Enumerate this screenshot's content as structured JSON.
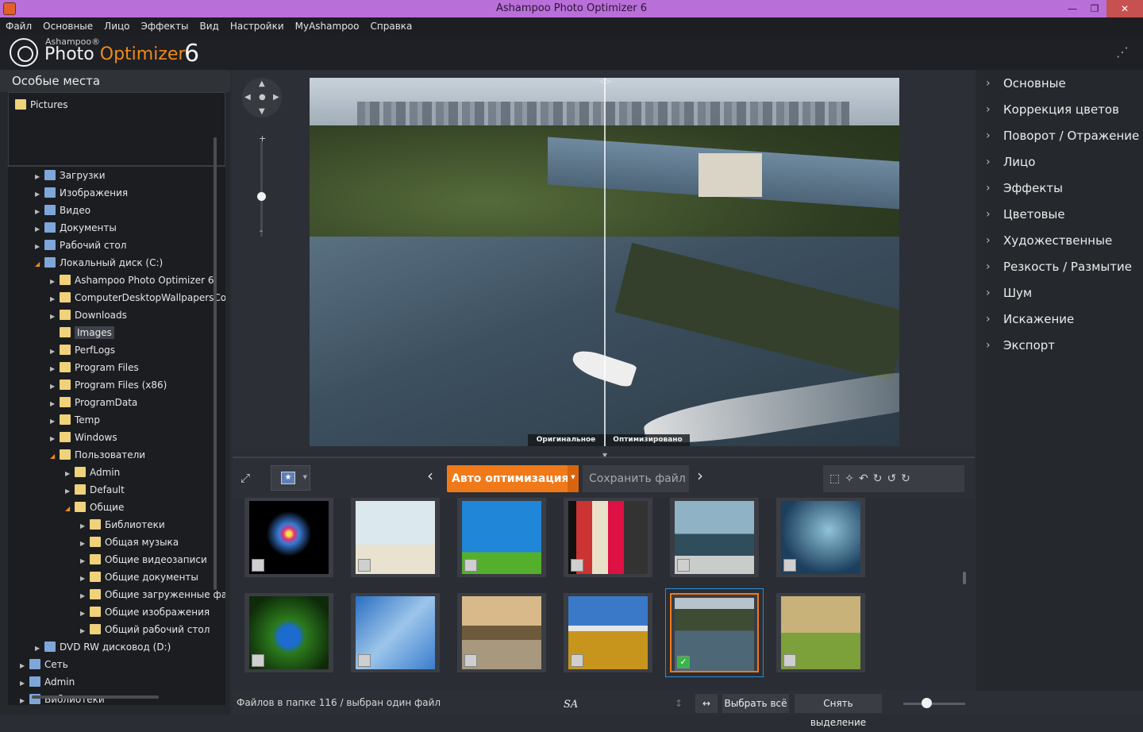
{
  "window": {
    "title": "Ashampoo Photo Optimizer 6"
  },
  "menu": [
    "Файл",
    "Основные",
    "Лицо",
    "Эффекты",
    "Вид",
    "Настройки",
    "MyAshampoo",
    "Справка"
  ],
  "logo": {
    "brand": "Ashampoo®",
    "name_a": "Photo ",
    "name_b": "Optimizer",
    "version": "6"
  },
  "left": {
    "places_title": "Особые места",
    "places": [
      {
        "label": "Pictures"
      }
    ],
    "tree": [
      {
        "label": "Загрузки",
        "indent": 0,
        "state": "closed",
        "icon": "sys"
      },
      {
        "label": "Изображения",
        "indent": 0,
        "state": "closed",
        "icon": "sys"
      },
      {
        "label": "Видео",
        "indent": 0,
        "state": "closed",
        "icon": "sys"
      },
      {
        "label": "Документы",
        "indent": 0,
        "state": "closed",
        "icon": "sys"
      },
      {
        "label": "Рабочий стол",
        "indent": 0,
        "state": "closed",
        "icon": "sys"
      },
      {
        "label": "Локальный диск (C:)",
        "indent": 0,
        "state": "open",
        "icon": "sys"
      },
      {
        "label": "Ashampoo Photo Optimizer 6",
        "indent": 1,
        "state": "closed"
      },
      {
        "label": "ComputerDesktopWallpapersCo",
        "indent": 1,
        "state": "closed"
      },
      {
        "label": "Downloads",
        "indent": 1,
        "state": "closed"
      },
      {
        "label": "Images",
        "indent": 1,
        "state": "none",
        "selected": true
      },
      {
        "label": "PerfLogs",
        "indent": 1,
        "state": "closed"
      },
      {
        "label": "Program Files",
        "indent": 1,
        "state": "closed"
      },
      {
        "label": "Program Files (x86)",
        "indent": 1,
        "state": "closed"
      },
      {
        "label": "ProgramData",
        "indent": 1,
        "state": "closed"
      },
      {
        "label": "Temp",
        "indent": 1,
        "state": "closed"
      },
      {
        "label": "Windows",
        "indent": 1,
        "state": "closed"
      },
      {
        "label": "Пользователи",
        "indent": 1,
        "state": "open"
      },
      {
        "label": "Admin",
        "indent": 2,
        "state": "closed"
      },
      {
        "label": "Default",
        "indent": 2,
        "state": "closed"
      },
      {
        "label": "Общие",
        "indent": 2,
        "state": "open"
      },
      {
        "label": "Библиотеки",
        "indent": 3,
        "state": "closed"
      },
      {
        "label": "Общая музыка",
        "indent": 3,
        "state": "closed"
      },
      {
        "label": "Общие видеозаписи",
        "indent": 3,
        "state": "closed"
      },
      {
        "label": "Общие документы",
        "indent": 3,
        "state": "closed"
      },
      {
        "label": "Общие загруженные фа",
        "indent": 3,
        "state": "closed"
      },
      {
        "label": "Общие изображения",
        "indent": 3,
        "state": "closed"
      },
      {
        "label": "Общий рабочий стол",
        "indent": 3,
        "state": "closed"
      },
      {
        "label": "DVD RW дисковод (D:)",
        "indent": 0,
        "state": "closed",
        "icon": "sys"
      },
      {
        "label": "Сеть",
        "indent": -1,
        "state": "closed",
        "icon": "sys"
      },
      {
        "label": "Admin",
        "indent": -1,
        "state": "closed",
        "icon": "sys"
      },
      {
        "label": "Библиотеки",
        "indent": -1,
        "state": "closed",
        "icon": "sys"
      }
    ]
  },
  "viewer": {
    "caption_original": "Оригинальное",
    "caption_optimized": "Оптимизировано",
    "zoom_plus": "+",
    "zoom_minus": "-"
  },
  "right_menu": [
    "Основные",
    "Коррекция цветов",
    "Поворот / Отражение",
    "Лицо",
    "Эффекты",
    "Цветовые",
    "Художественные",
    "Резкость / Размытие",
    "Шум",
    "Искажение",
    "Экспорт"
  ],
  "toolbar": {
    "auto_label": "Авто оптимизация",
    "save_label": "Сохранить файл"
  },
  "thumbs": [
    {
      "theme": "fireworks",
      "selected": false
    },
    {
      "theme": "palm-beach",
      "selected": false
    },
    {
      "theme": "balloon-meadow",
      "selected": false
    },
    {
      "theme": "cocktails",
      "selected": false
    },
    {
      "theme": "rocky-coast",
      "selected": false
    },
    {
      "theme": "wave-dragon",
      "selected": false
    },
    {
      "theme": "butterfly",
      "selected": false
    },
    {
      "theme": "cirrus-sky",
      "selected": false
    },
    {
      "theme": "sunset-cliffs",
      "selected": false
    },
    {
      "theme": "wheat-field",
      "selected": false
    },
    {
      "theme": "city-bay",
      "selected": true
    },
    {
      "theme": "fantasy-castle",
      "selected": false
    }
  ],
  "status": {
    "text": "Файлов в папке 116 / выбран один файл",
    "signature": "SA",
    "select_all": "Выбрать всё",
    "deselect": "Снять выделение"
  },
  "colors": {
    "accent": "#f07a1a",
    "titlebar": "#b96fd8",
    "panel": "#25282d"
  }
}
